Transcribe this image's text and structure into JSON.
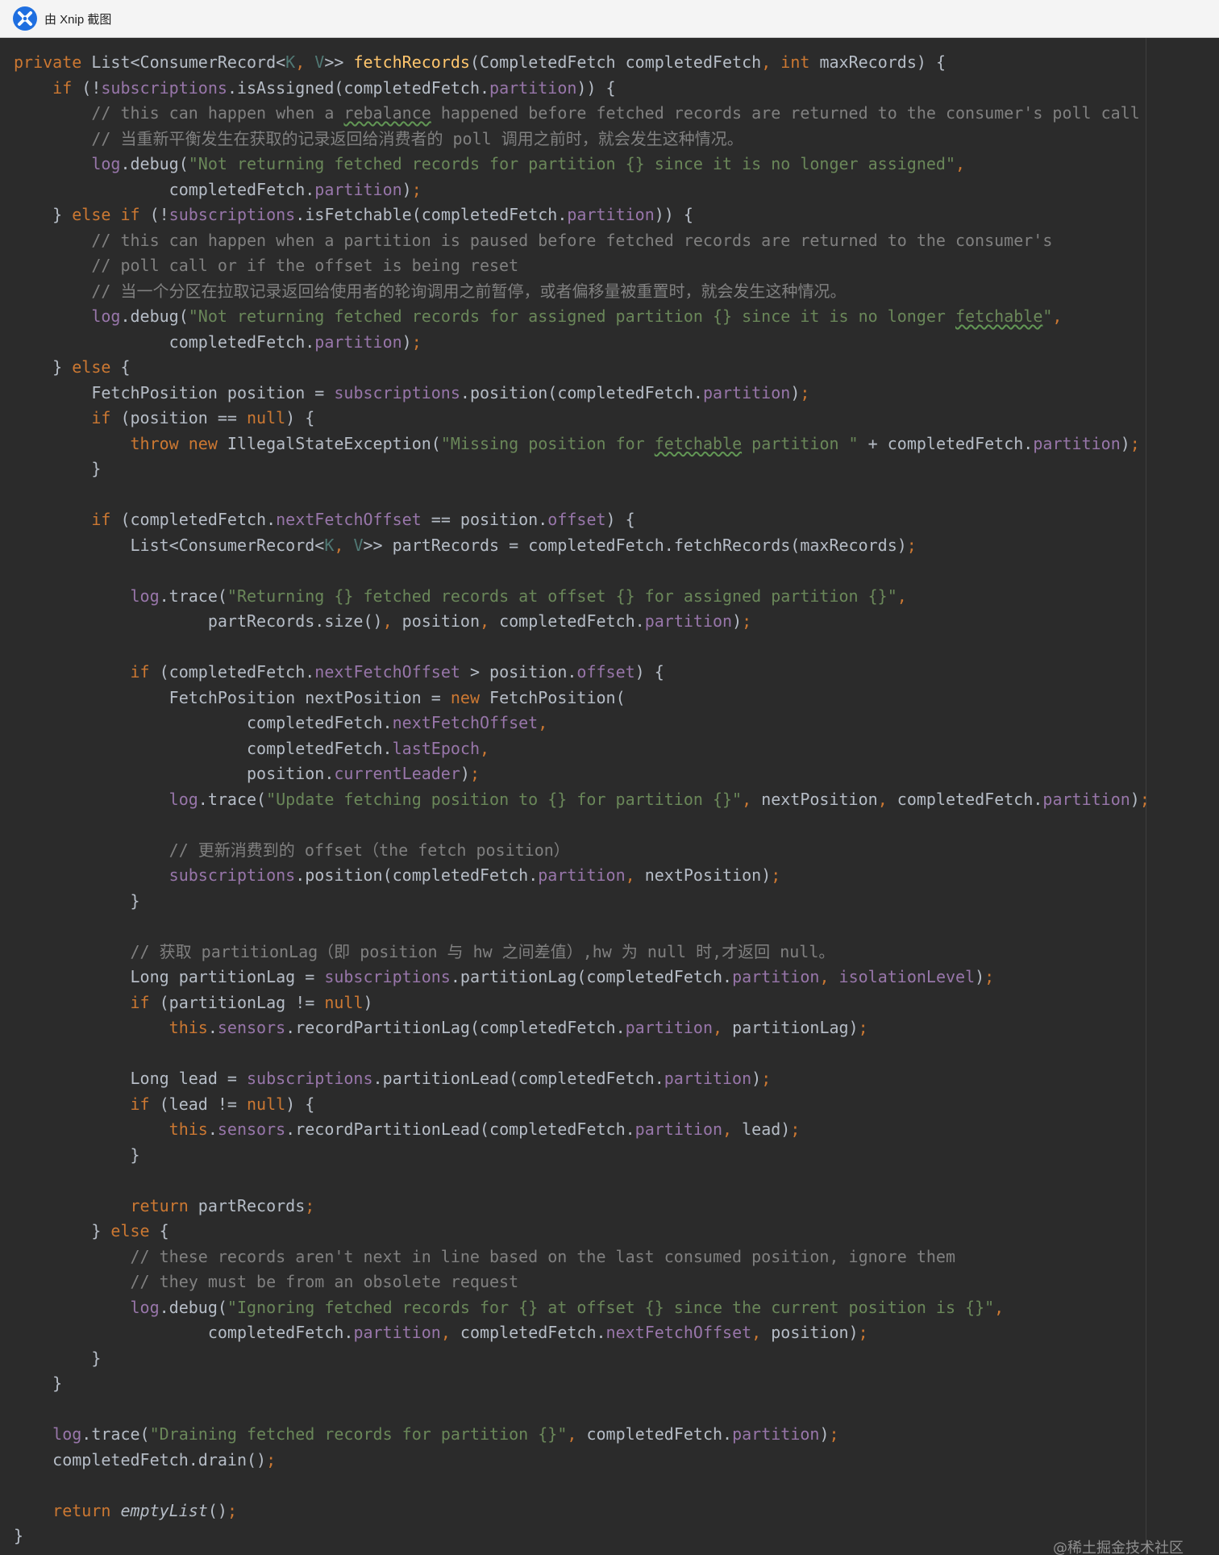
{
  "window": {
    "title": "由 Xnip 截图",
    "app_icon": "xnip-app-icon"
  },
  "watermark": "@稀土掘金技术社区",
  "palette": {
    "background": "#2b2b2b",
    "keyword": "#cc7832",
    "method": "#ffc66d",
    "field": "#9876aa",
    "string": "#6a8759",
    "comment": "#808080",
    "generic": "#507874",
    "plain": "#b6bdc7"
  },
  "code": {
    "language": "java",
    "lines": [
      [
        [
          "kw",
          "private "
        ],
        [
          "pl",
          "List<ConsumerRecord<"
        ],
        [
          "gen",
          "K"
        ],
        [
          "sm",
          ", "
        ],
        [
          "gen",
          "V"
        ],
        [
          "pl",
          ">> "
        ],
        [
          "fn",
          "fetchRecords"
        ],
        [
          "pl",
          "(CompletedFetch completedFetch"
        ],
        [
          "sm",
          ", "
        ],
        [
          "kw",
          "int "
        ],
        [
          "pl",
          "maxRecords) {"
        ]
      ],
      [
        [
          "pl",
          "    "
        ],
        [
          "kw",
          "if "
        ],
        [
          "pl",
          "(!"
        ],
        [
          "fld",
          "subscriptions"
        ],
        [
          "pl",
          ".isAssigned(completedFetch."
        ],
        [
          "fld",
          "partition"
        ],
        [
          "pl",
          ")) {"
        ]
      ],
      [
        [
          "cmt",
          "        // this can happen when a "
        ],
        [
          "cmt",
          "rebalance",
          "typo"
        ],
        [
          "cmt",
          " happened before fetched records are returned to the consumer's poll call"
        ]
      ],
      [
        [
          "cmt",
          "        // 当重新平衡发生在获取的记录返回给消费者的 poll 调用之前时，就会发生这种情况。"
        ]
      ],
      [
        [
          "pl",
          "        "
        ],
        [
          "fld",
          "log"
        ],
        [
          "pl",
          ".debug("
        ],
        [
          "str",
          "\"Not returning fetched records for partition {} since it is no longer assigned\""
        ],
        [
          "sm",
          ","
        ]
      ],
      [
        [
          "pl",
          "                completedFetch."
        ],
        [
          "fld",
          "partition"
        ],
        [
          "pl",
          ")"
        ],
        [
          "sm",
          ";"
        ]
      ],
      [
        [
          "pl",
          "    } "
        ],
        [
          "kw",
          "else if "
        ],
        [
          "pl",
          "(!"
        ],
        [
          "fld",
          "subscriptions"
        ],
        [
          "pl",
          ".isFetchable(completedFetch."
        ],
        [
          "fld",
          "partition"
        ],
        [
          "pl",
          ")) {"
        ]
      ],
      [
        [
          "cmt",
          "        // this can happen when a partition is paused before fetched records are returned to the consumer's"
        ]
      ],
      [
        [
          "cmt",
          "        // poll call or if the offset is being reset"
        ]
      ],
      [
        [
          "cmt",
          "        // 当一个分区在拉取记录返回给使用者的轮询调用之前暂停，或者偏移量被重置时，就会发生这种情况。"
        ]
      ],
      [
        [
          "pl",
          "        "
        ],
        [
          "fld",
          "log"
        ],
        [
          "pl",
          ".debug("
        ],
        [
          "str",
          "\"Not returning fetched records for assigned partition {} since it is no longer "
        ],
        [
          "str",
          "fetchable",
          "typo"
        ],
        [
          "str",
          "\""
        ],
        [
          "sm",
          ","
        ]
      ],
      [
        [
          "pl",
          "                completedFetch."
        ],
        [
          "fld",
          "partition"
        ],
        [
          "pl",
          ")"
        ],
        [
          "sm",
          ";"
        ]
      ],
      [
        [
          "pl",
          "    } "
        ],
        [
          "kw",
          "else "
        ],
        [
          "pl",
          "{"
        ]
      ],
      [
        [
          "pl",
          "        FetchPosition position = "
        ],
        [
          "fld",
          "subscriptions"
        ],
        [
          "pl",
          ".position(completedFetch."
        ],
        [
          "fld",
          "partition"
        ],
        [
          "pl",
          ")"
        ],
        [
          "sm",
          ";"
        ]
      ],
      [
        [
          "pl",
          "        "
        ],
        [
          "kw",
          "if "
        ],
        [
          "pl",
          "(position == "
        ],
        [
          "kw",
          "null"
        ],
        [
          "pl",
          ") {"
        ]
      ],
      [
        [
          "pl",
          "            "
        ],
        [
          "kw",
          "throw new "
        ],
        [
          "pl",
          "IllegalStateException("
        ],
        [
          "str",
          "\"Missing position for "
        ],
        [
          "str",
          "fetchable",
          "typo"
        ],
        [
          "str",
          " partition \""
        ],
        [
          "pl",
          " + completedFetch."
        ],
        [
          "fld",
          "partition"
        ],
        [
          "pl",
          ")"
        ],
        [
          "sm",
          ";"
        ]
      ],
      [
        [
          "pl",
          "        }"
        ]
      ],
      [],
      [
        [
          "pl",
          "        "
        ],
        [
          "kw",
          "if "
        ],
        [
          "pl",
          "(completedFetch."
        ],
        [
          "fld",
          "nextFetchOffset"
        ],
        [
          "pl",
          " == position."
        ],
        [
          "fld",
          "offset"
        ],
        [
          "pl",
          ") {"
        ]
      ],
      [
        [
          "pl",
          "            List<ConsumerRecord<"
        ],
        [
          "gen",
          "K"
        ],
        [
          "sm",
          ", "
        ],
        [
          "gen",
          "V"
        ],
        [
          "pl",
          ">> partRecords = completedFetch.fetchRecords(maxRecords)"
        ],
        [
          "sm",
          ";"
        ]
      ],
      [],
      [
        [
          "pl",
          "            "
        ],
        [
          "fld",
          "log"
        ],
        [
          "pl",
          ".trace("
        ],
        [
          "str",
          "\"Returning {} fetched records at offset {} for assigned partition {}\""
        ],
        [
          "sm",
          ","
        ]
      ],
      [
        [
          "pl",
          "                    partRecords.size()"
        ],
        [
          "sm",
          ", "
        ],
        [
          "pl",
          "position"
        ],
        [
          "sm",
          ", "
        ],
        [
          "pl",
          "completedFetch."
        ],
        [
          "fld",
          "partition"
        ],
        [
          "pl",
          ")"
        ],
        [
          "sm",
          ";"
        ]
      ],
      [],
      [
        [
          "pl",
          "            "
        ],
        [
          "kw",
          "if "
        ],
        [
          "pl",
          "(completedFetch."
        ],
        [
          "fld",
          "nextFetchOffset"
        ],
        [
          "pl",
          " > position."
        ],
        [
          "fld",
          "offset"
        ],
        [
          "pl",
          ") {"
        ]
      ],
      [
        [
          "pl",
          "                FetchPosition nextPosition = "
        ],
        [
          "kw",
          "new "
        ],
        [
          "pl",
          "FetchPosition("
        ]
      ],
      [
        [
          "pl",
          "                        completedFetch."
        ],
        [
          "fld",
          "nextFetchOffset"
        ],
        [
          "sm",
          ","
        ]
      ],
      [
        [
          "pl",
          "                        completedFetch."
        ],
        [
          "fld",
          "lastEpoch"
        ],
        [
          "sm",
          ","
        ]
      ],
      [
        [
          "pl",
          "                        position."
        ],
        [
          "fld",
          "currentLeader"
        ],
        [
          "pl",
          ")"
        ],
        [
          "sm",
          ";"
        ]
      ],
      [
        [
          "pl",
          "                "
        ],
        [
          "fld",
          "log"
        ],
        [
          "pl",
          ".trace("
        ],
        [
          "str",
          "\"Update fetching position to {} for partition {}\""
        ],
        [
          "sm",
          ", "
        ],
        [
          "pl",
          "nextPosition"
        ],
        [
          "sm",
          ", "
        ],
        [
          "pl",
          "completedFetch."
        ],
        [
          "fld",
          "partition"
        ],
        [
          "pl",
          ")"
        ],
        [
          "sm",
          ";"
        ]
      ],
      [],
      [
        [
          "cmt",
          "                // 更新消费到的 offset（the fetch position）"
        ]
      ],
      [
        [
          "pl",
          "                "
        ],
        [
          "fld",
          "subscriptions"
        ],
        [
          "pl",
          ".position(completedFetch."
        ],
        [
          "fld",
          "partition"
        ],
        [
          "sm",
          ", "
        ],
        [
          "pl",
          "nextPosition)"
        ],
        [
          "sm",
          ";"
        ]
      ],
      [
        [
          "pl",
          "            }"
        ]
      ],
      [],
      [
        [
          "cmt",
          "            // 获取 partitionLag（即 position 与 hw 之间差值）,hw 为 null 时,才返回 null。"
        ]
      ],
      [
        [
          "pl",
          "            Long partitionLag = "
        ],
        [
          "fld",
          "subscriptions"
        ],
        [
          "pl",
          ".partitionLag(completedFetch."
        ],
        [
          "fld",
          "partition"
        ],
        [
          "sm",
          ", "
        ],
        [
          "fld",
          "isolationLevel"
        ],
        [
          "pl",
          ")"
        ],
        [
          "sm",
          ";"
        ]
      ],
      [
        [
          "pl",
          "            "
        ],
        [
          "kw",
          "if "
        ],
        [
          "pl",
          "(partitionLag != "
        ],
        [
          "kw",
          "null"
        ],
        [
          "pl",
          ")"
        ]
      ],
      [
        [
          "pl",
          "                "
        ],
        [
          "kw",
          "this"
        ],
        [
          "pl",
          "."
        ],
        [
          "fld",
          "sensors"
        ],
        [
          "pl",
          ".recordPartitionLag(completedFetch."
        ],
        [
          "fld",
          "partition"
        ],
        [
          "sm",
          ", "
        ],
        [
          "pl",
          "partitionLag)"
        ],
        [
          "sm",
          ";"
        ]
      ],
      [],
      [
        [
          "pl",
          "            Long lead = "
        ],
        [
          "fld",
          "subscriptions"
        ],
        [
          "pl",
          ".partitionLead(completedFetch."
        ],
        [
          "fld",
          "partition"
        ],
        [
          "pl",
          ")"
        ],
        [
          "sm",
          ";"
        ]
      ],
      [
        [
          "pl",
          "            "
        ],
        [
          "kw",
          "if "
        ],
        [
          "pl",
          "(lead != "
        ],
        [
          "kw",
          "null"
        ],
        [
          "pl",
          ") {"
        ]
      ],
      [
        [
          "pl",
          "                "
        ],
        [
          "kw",
          "this"
        ],
        [
          "pl",
          "."
        ],
        [
          "fld",
          "sensors"
        ],
        [
          "pl",
          ".recordPartitionLead(completedFetch."
        ],
        [
          "fld",
          "partition"
        ],
        [
          "sm",
          ", "
        ],
        [
          "pl",
          "lead)"
        ],
        [
          "sm",
          ";"
        ]
      ],
      [
        [
          "pl",
          "            }"
        ]
      ],
      [],
      [
        [
          "pl",
          "            "
        ],
        [
          "kw",
          "return "
        ],
        [
          "pl",
          "partRecords"
        ],
        [
          "sm",
          ";"
        ]
      ],
      [
        [
          "pl",
          "        } "
        ],
        [
          "kw",
          "else "
        ],
        [
          "pl",
          "{"
        ]
      ],
      [
        [
          "cmt",
          "            // these records aren't next in line based on the last consumed position, ignore them"
        ]
      ],
      [
        [
          "cmt",
          "            // they must be from an obsolete request"
        ]
      ],
      [
        [
          "pl",
          "            "
        ],
        [
          "fld",
          "log"
        ],
        [
          "pl",
          ".debug("
        ],
        [
          "str",
          "\"Ignoring fetched records for {} at offset {} since the current position is {}\""
        ],
        [
          "sm",
          ","
        ]
      ],
      [
        [
          "pl",
          "                    completedFetch."
        ],
        [
          "fld",
          "partition"
        ],
        [
          "sm",
          ", "
        ],
        [
          "pl",
          "completedFetch."
        ],
        [
          "fld",
          "nextFetchOffset"
        ],
        [
          "sm",
          ", "
        ],
        [
          "pl",
          "position)"
        ],
        [
          "sm",
          ";"
        ]
      ],
      [
        [
          "pl",
          "        }"
        ]
      ],
      [
        [
          "pl",
          "    }"
        ]
      ],
      [],
      [
        [
          "pl",
          "    "
        ],
        [
          "fld",
          "log"
        ],
        [
          "pl",
          ".trace("
        ],
        [
          "str",
          "\"Draining fetched records for partition {}\""
        ],
        [
          "sm",
          ", "
        ],
        [
          "pl",
          "completedFetch."
        ],
        [
          "fld",
          "partition"
        ],
        [
          "pl",
          ")"
        ],
        [
          "sm",
          ";"
        ]
      ],
      [
        [
          "pl",
          "    completedFetch.drain()"
        ],
        [
          "sm",
          ";"
        ]
      ],
      [],
      [
        [
          "pl",
          "    "
        ],
        [
          "kw",
          "return "
        ],
        [
          "it",
          "emptyList"
        ],
        [
          "pl",
          "()"
        ],
        [
          "sm",
          ";"
        ]
      ],
      [
        [
          "pl",
          "}"
        ]
      ]
    ]
  }
}
